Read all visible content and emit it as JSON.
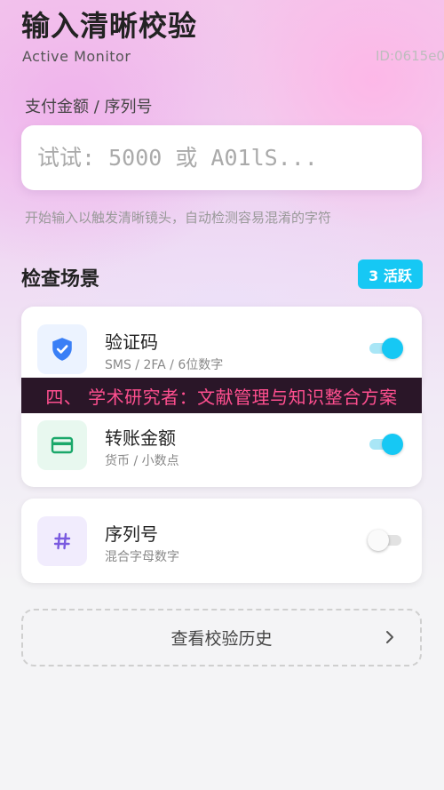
{
  "header": {
    "title": "输入清晰校验",
    "subtitle": "Active Monitor",
    "device_id": "ID:0615e0"
  },
  "input": {
    "label": "支付金额 / 序列号",
    "value": "",
    "placeholder": "试试: 5000 或 A01lS...",
    "hint": "开始输入以触发清晰镜头，自动检测容易混淆的字符"
  },
  "scenes": {
    "title": "检查场景",
    "badge": "3 活跃",
    "items": [
      {
        "title": "验证码",
        "desc": "SMS / 2FA / 6位数字",
        "icon": "shield-check-icon",
        "enabled": true
      },
      {
        "title": "转账金额",
        "desc": "货币 / 小数点",
        "icon": "credit-card-icon",
        "enabled": true
      },
      {
        "title": "序列号",
        "desc": "混合字母数字",
        "icon": "hash-icon",
        "enabled": false
      }
    ]
  },
  "banner": {
    "text": "四、 学术研究者：文献管理与知识整合方案"
  },
  "history": {
    "label": "查看校验历史",
    "icon": "chevron-right-icon"
  },
  "colors": {
    "accent": "#16c8f4",
    "shield_blue": "#3a7ff6",
    "card_green": "#1aa86a",
    "hash_purple": "#7a5ae0",
    "banner_text": "#ff4f8f",
    "banner_bg": "#2a1628"
  }
}
